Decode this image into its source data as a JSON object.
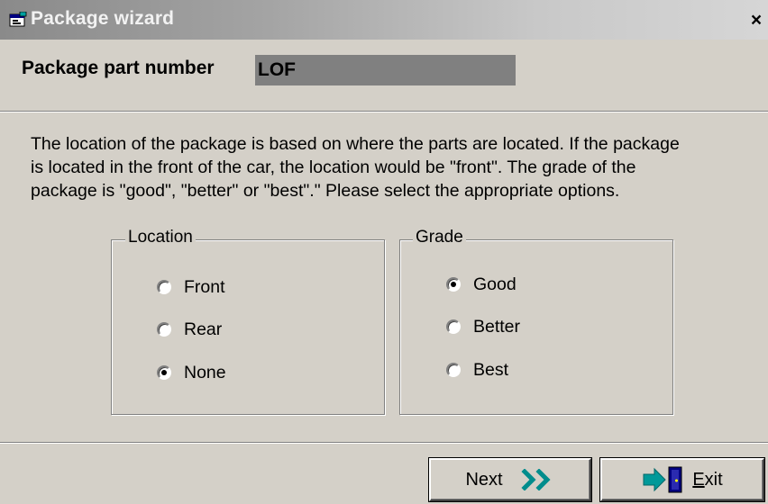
{
  "window": {
    "title": "Package wizard",
    "close_glyph": "×"
  },
  "part": {
    "label": "Package part number",
    "value": "LOF"
  },
  "description": "The location of the package is based on where the parts are located.  If the package\nis located in the front of the car, the location would be \"front\".  The grade of the\npackage is \"good\", \"better\" or \"best\".\"  Please select the appropriate options.",
  "location": {
    "legend": "Location",
    "options": [
      {
        "label": "Front",
        "checked": false
      },
      {
        "label": "Rear",
        "checked": false
      },
      {
        "label": "None",
        "checked": true
      }
    ]
  },
  "grade": {
    "legend": "Grade",
    "options": [
      {
        "label": "Good",
        "checked": true
      },
      {
        "label": "Better",
        "checked": false
      },
      {
        "label": "Best",
        "checked": false
      }
    ]
  },
  "buttons": {
    "next_label": "Next",
    "next_icon": "double-chevron-right-icon",
    "exit_label_first": "E",
    "exit_label_rest": "xit",
    "exit_icon": "exit-door-icon"
  },
  "colors": {
    "face": "#d4d0c8",
    "field": "#808080",
    "accent_teal": "#00a0a0",
    "door_blue": "#000080"
  }
}
